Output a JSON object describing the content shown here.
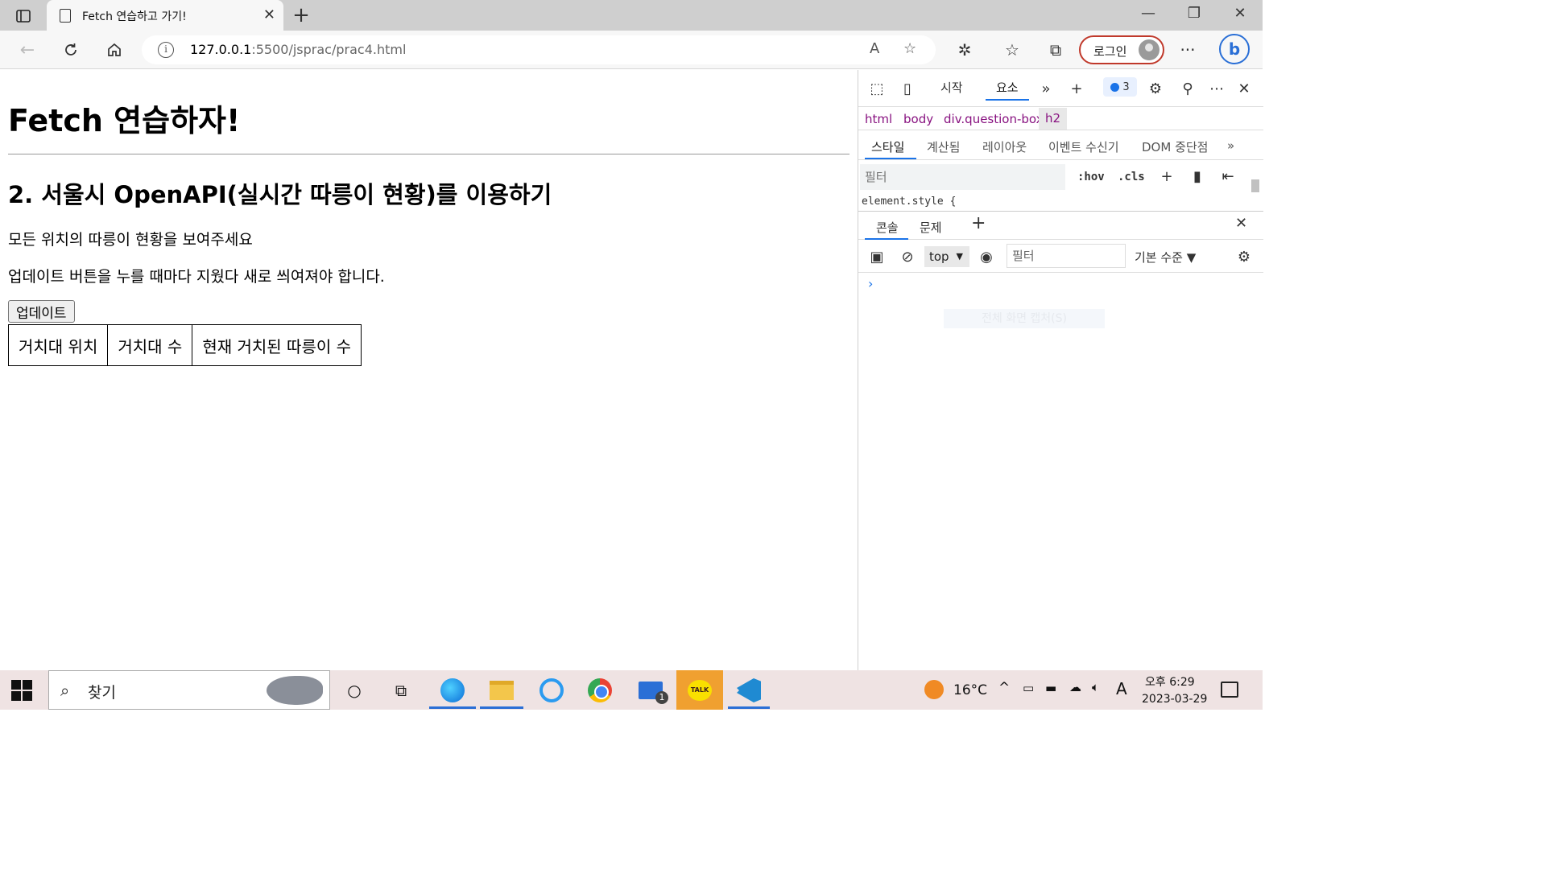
{
  "browser": {
    "tab_title": "Fetch 연습하고 가기!",
    "url_host": "127.0.0.1",
    "url_path": ":5500/jsprac/prac4.html",
    "login_label": "로그인"
  },
  "page": {
    "title": "Fetch 연습하자!",
    "section_title": "2. 서울시 OpenAPI(실시간 따릉이 현황)를 이용하기",
    "paragraph1": "모든 위치의 따릉이 현황을 보여주세요",
    "paragraph2": "업데이트 버튼을 누를 때마다 지웠다 새로 씌여져야 합니다.",
    "update_button": "업데이트",
    "table_headers": [
      "거치대 위치",
      "거치대 수",
      "현재 거치된 따릉이 수"
    ]
  },
  "devtools": {
    "tabs": [
      "시작",
      "요소"
    ],
    "active_tab": "요소",
    "issues_count": "3",
    "breadcrumbs": [
      "html",
      "body",
      "div.question-box",
      "h2"
    ],
    "subtabs": [
      "스타일",
      "계산됨",
      "레이아웃",
      "이벤트 수신기",
      "DOM 중단점"
    ],
    "styles_filter_placeholder": "필터",
    "hov_label": ":hov",
    "cls_label": ".cls",
    "styles_code": "element.style {",
    "drawer_tabs": [
      "콘솔",
      "문제"
    ],
    "context": "top",
    "console_filter_placeholder": "필터",
    "level_label": "기본 수준",
    "prompt": "›",
    "ghost_tooltip": "전체 화면 캡처(S)"
  },
  "taskbar": {
    "search_label": "찾기",
    "weather_temp": "16°C",
    "ime": "A",
    "clock_time": "오후 6:29",
    "clock_date": "2023-03-29",
    "mail_badge": "1",
    "talk_label": "TALK"
  },
  "icons": {
    "search": "search-icon",
    "refresh": "refresh-icon",
    "home": "home-icon",
    "back": "back-arrow-icon"
  }
}
